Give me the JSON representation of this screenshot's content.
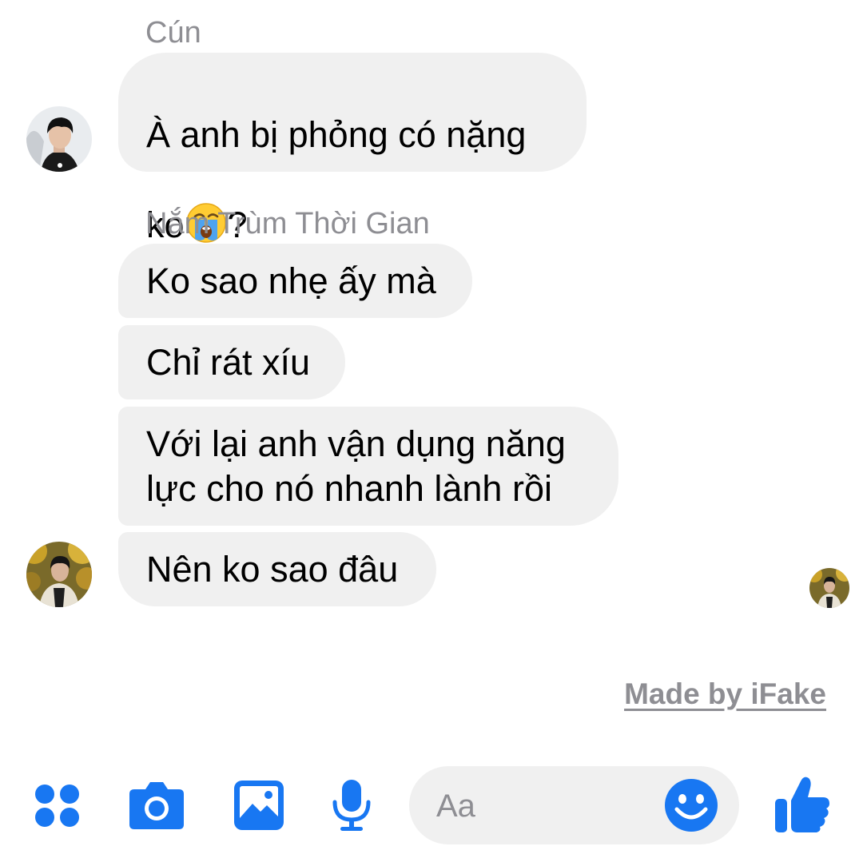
{
  "conversation": {
    "group1": {
      "sender": "Cún",
      "messages": [
        {
          "text": "À anh bị phỏng có nặng\nko",
          "suffix": "?",
          "emoji": "loudly-crying-face"
        }
      ]
    },
    "group2": {
      "sender": "Nắm Trùm Thời Gian",
      "messages": [
        {
          "text": "Ko sao nhẹ ấy mà"
        },
        {
          "text": "Chỉ rát xíu"
        },
        {
          "text": "Với lại anh vận dụng năng\nlực cho nó nhanh lành rồi"
        },
        {
          "text": "Nên ko sao đâu"
        }
      ]
    }
  },
  "watermark": "Made by iFake",
  "composer": {
    "placeholder": "Aa"
  },
  "toolbar": {
    "icons": [
      "apps-icon",
      "camera-icon",
      "gallery-icon",
      "microphone-icon",
      "emoji-icon",
      "like-icon"
    ],
    "accent_color": "#1877f2"
  },
  "colors": {
    "bubble": "#f0f0f0",
    "secondary_text": "#8e8e93"
  }
}
